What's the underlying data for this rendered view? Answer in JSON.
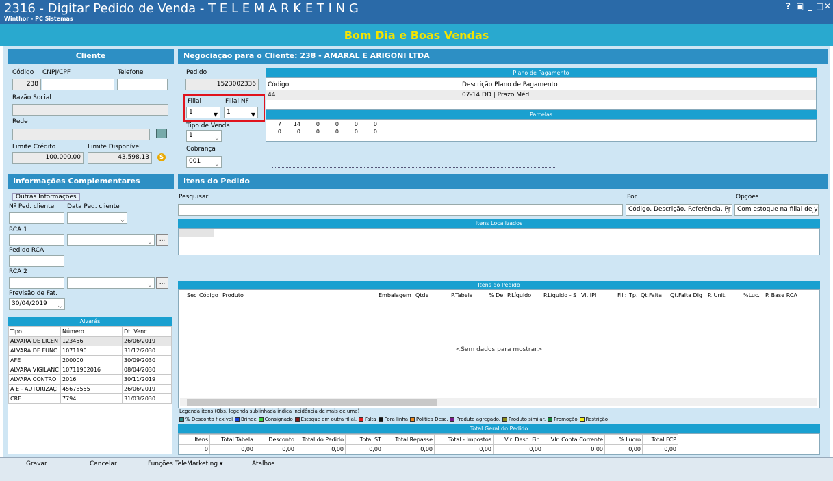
{
  "window": {
    "title": "2316 - Digitar Pedido de Venda - T E L E M A R K E T I N G",
    "subtitle": "Winthor - PC Sistemas",
    "help": "?",
    "restore": "▣",
    "minimize": "_",
    "maximize": "□",
    "close": "✕"
  },
  "greeting": "Bom Dia e Boas Vendas",
  "cliente": {
    "header": "Cliente",
    "codigo_label": "Código",
    "codigo_value": "238",
    "cnpj_label": "CNPJ/CPF",
    "cnpj_value": "",
    "telefone_label": "Telefone",
    "telefone_value": "",
    "razao_label": "Razão Social",
    "razao_value": "",
    "rede_label": "Rede",
    "rede_value": "",
    "limite_credito_label": "Limite Crédito",
    "limite_credito_value": "100.000,00",
    "limite_disp_label": "Limite Disponível",
    "limite_disp_value": "43.598,13",
    "dollar": "$"
  },
  "info": {
    "header": "Informações Complementares",
    "tab": "Outras Informações",
    "nped_label": "Nº Ped. cliente",
    "nped_value": "",
    "data_label": "Data Ped. cliente",
    "data_value": "",
    "rca1_label": "RCA 1",
    "rca1_value": "",
    "pedido_rca_label": "Pedido RCA",
    "pedido_rca_value": "",
    "rca2_label": "RCA 2",
    "rca2_value": "",
    "previsao_label": "Previsão de Fat.",
    "previsao_value": "30/04/2019",
    "ellipsis": "..."
  },
  "alvaras": {
    "title": "Alvarás",
    "columns": [
      "Tipo",
      "Número",
      "Dt. Venc."
    ],
    "rows": [
      [
        "ALVARA DE LICEN",
        "123456",
        "26/06/2019"
      ],
      [
        "ALVARA DE FUNC",
        "1071190",
        "31/12/2030"
      ],
      [
        "AFE",
        "200000",
        "30/09/2030"
      ],
      [
        "ALVARA VIGILANC",
        "10711902016",
        "08/04/2030"
      ],
      [
        "ALVARA CONTROI",
        "2016",
        "30/11/2019"
      ],
      [
        "A E - AUTORIZAÇ",
        "45678555",
        "26/06/2019"
      ],
      [
        "CRF",
        "7794",
        "31/03/2030"
      ]
    ]
  },
  "negociacao": {
    "header": "Negociação para o Cliente: 238 - AMARAL E ARIGONI LTDA",
    "pedido_label": "Pedido",
    "pedido_value": "1523002336",
    "filial_label": "Filial",
    "filial_value": "1",
    "filial_nf_label": "Filial NF",
    "filial_nf_value": "1",
    "tipo_venda_label": "Tipo de Venda",
    "tipo_venda_value": "1",
    "cobranca_label": "Cobrança",
    "cobranca_value": "001",
    "plano_title": "Plano de Pagamento",
    "plano_col1": "Código",
    "plano_col2": "Descrição Plano de Pagamento",
    "plano_codigo": "44",
    "plano_desc": "07-14 DD | Prazo Méd",
    "parcelas_title": "Parcelas",
    "parcelas_row1": [
      "7",
      "14",
      "0",
      "0",
      "0",
      "0"
    ],
    "parcelas_row2": [
      "0",
      "0",
      "0",
      "0",
      "0",
      "0"
    ]
  },
  "itens": {
    "header": "Itens do Pedido",
    "pesquisar_label": "Pesquisar",
    "pesquisar_value": "",
    "por_label": "Por",
    "por_value": "Código, Descrição, Referência, Pr",
    "opcoes_label": "Opções",
    "opcoes_value": "Com estoque na filial de v",
    "localizados_title": "Itens Localizados",
    "pedido_title": "Itens do Pedido",
    "columns": [
      "Sec",
      "Código",
      "Produto",
      "Embalagem",
      "Qtde",
      "P.Tabela",
      "% De:",
      "P.Líquido",
      "P.Líquido - S",
      "Vl. IPI",
      "Fili:",
      "Tp.",
      "Qt.Falta",
      "Qt.Falta Dig",
      "P. Unit.",
      "%Luc.",
      "P. Base RCA"
    ],
    "empty": "<Sem dados para mostrar>"
  },
  "legend": {
    "title": "Legenda itens (Obs. legenda sublinhada indica incidência de mais de uma)",
    "items": [
      {
        "label": "% Desconto flexível",
        "color": "#2a8a80"
      },
      {
        "label": "Brinde",
        "color": "#1a3fd6"
      },
      {
        "label": "Consignado",
        "color": "#39d33a"
      },
      {
        "label": "Estoque em outra filial.",
        "color": "#8a1a1a"
      },
      {
        "label": "Falta",
        "color": "#e21c1c"
      },
      {
        "label": "Fora linha",
        "color": "#111111"
      },
      {
        "label": "Política Desc.",
        "color": "#f08a1c"
      },
      {
        "label": "Produto agregado.",
        "color": "#7a1a8a"
      },
      {
        "label": "Produto similar.",
        "color": "#8a8a1a"
      },
      {
        "label": "Promoção",
        "color": "#1a8a3a"
      },
      {
        "label": "Restrição",
        "color": "#f4f01a"
      }
    ]
  },
  "totais": {
    "title": "Total Geral do Pedido",
    "labels": [
      "Itens",
      "Total Tabela",
      "Desconto",
      "Total do Pedido",
      "Total ST",
      "Total Repasse",
      "Total - Impostos",
      "Vlr. Desc. Fin.",
      "Vlr. Conta Corrente",
      "% Lucro",
      "Total FCP"
    ],
    "values": [
      "0",
      "0,00",
      "0,00",
      "0,00",
      "0,00",
      "0,00",
      "0,00",
      "0,00",
      "0,00",
      "0,00",
      "0,00"
    ]
  },
  "bottom": {
    "gravar": "Gravar",
    "cancelar": "Cancelar",
    "funcoes": "Funções TeleMarketing",
    "atalhos": "Atalhos"
  }
}
